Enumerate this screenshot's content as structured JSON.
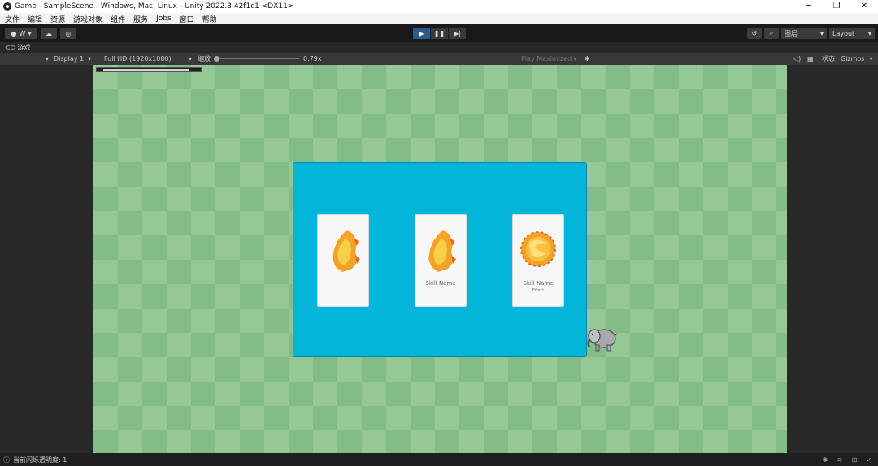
{
  "window": {
    "title": "Game - SampleScene - Windows, Mac, Linux - Unity 2022.3.42f1c1 <DX11>",
    "controls": [
      "─",
      "❐",
      "✕"
    ]
  },
  "menu": [
    "文件",
    "编辑",
    "资源",
    "游戏对象",
    "组件",
    "服务",
    "Jobs",
    "窗口",
    "帮助"
  ],
  "toolbar": {
    "account": "W",
    "layers": "图层",
    "layout": "Layout"
  },
  "tab": {
    "label": "游戏"
  },
  "gamebar": {
    "display": "Display 1",
    "resolution": "Full HD (1920x1080)",
    "scale_label": "缩放",
    "scale_value": "0.79x",
    "play_mode": "Play Maximized",
    "stats": "状态",
    "gizmos": "Gizmos"
  },
  "game": {
    "health_fraction": 0.95,
    "cards": [
      {
        "top": "",
        "name": "",
        "desc": ""
      },
      {
        "top": "",
        "name": "Skill Name",
        "desc": ""
      },
      {
        "top": "",
        "name": "Skill Name",
        "desc": "Effect"
      }
    ]
  },
  "status": {
    "text": "当前闪烁透明度: 1"
  },
  "colors": {
    "panel": "#03b5d8",
    "grass_light": "#96c896",
    "grass_dark": "#84bc88",
    "play_active": "#2d5a8c"
  }
}
